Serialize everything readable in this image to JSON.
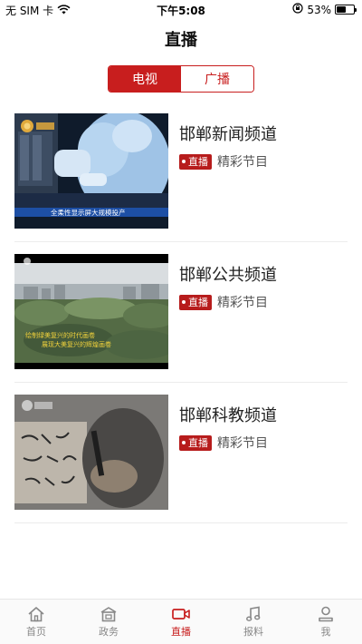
{
  "status_bar": {
    "carrier": "无 SIM 卡",
    "time": "下午5:08",
    "battery_percent": "53%",
    "battery_level": 0.53
  },
  "nav": {
    "title": "直播"
  },
  "segment": {
    "tabs": [
      {
        "label": "电视",
        "active": true
      },
      {
        "label": "广播",
        "active": false
      }
    ]
  },
  "channels": [
    {
      "name": "邯郸新闻频道",
      "live_label": "直播",
      "program": "精彩节目",
      "thumb_caption": "全柔性显示屏大规模投产"
    },
    {
      "name": "邯郸公共频道",
      "live_label": "直播",
      "program": "精彩节目",
      "thumb_caption_1": "绘制绿美复兴的时代画卷",
      "thumb_caption_2": "展现大美复兴的辉煌画卷"
    },
    {
      "name": "邯郸科教频道",
      "live_label": "直播",
      "program": "精彩节目"
    }
  ],
  "tab_bar": {
    "items": [
      {
        "label": "首页",
        "icon": "home-icon",
        "active": false
      },
      {
        "label": "政务",
        "icon": "government-icon",
        "active": false
      },
      {
        "label": "直播",
        "icon": "video-camera-icon",
        "active": true
      },
      {
        "label": "报料",
        "icon": "music-note-icon",
        "active": false
      },
      {
        "label": "我",
        "icon": "user-icon",
        "active": false
      }
    ]
  },
  "colors": {
    "accent": "#c81e1e",
    "badge": "#b71c1c"
  }
}
